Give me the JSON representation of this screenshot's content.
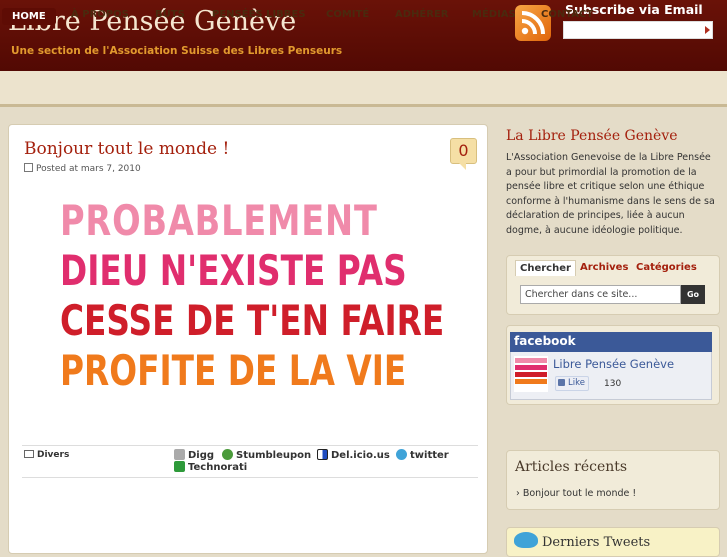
{
  "header": {
    "site_title": "Libre Pensée Genève",
    "tagline": "Une section de l'Association Suisse des Libres Penseurs",
    "subscribe_label": "Subscribe via Email",
    "subscribe_value": ""
  },
  "nav": {
    "items": [
      "HOME",
      "À PROPOS",
      "BUTS",
      "PENSÉES LIBRES",
      "COMITÉ",
      "ADHÉRER",
      "MÉDIAS",
      "CONTACT"
    ]
  },
  "post": {
    "title": "Bonjour tout le monde !",
    "meta": "Posted at mars 7, 2010",
    "comment_count": "0",
    "image_lines": [
      "PROBABLEMENT",
      "DIEU N'EXISTE PAS",
      "CESSE DE T'EN FAIRE",
      "PROFITE DE LA VIE"
    ],
    "category": "Divers",
    "share": [
      "Digg",
      "Stumbleupon",
      "Del.icio.us",
      "twitter",
      "Technorati"
    ]
  },
  "sidebar": {
    "about_title": "La Libre Pensée Genève",
    "about_text": "L'Association Genevoise de la Libre Pensée a pour but primordial la promotion de la pensée libre et critique selon une éthique conforme à l'humanisme dans le sens de sa déclaration de principes, liée à aucun dogme, à aucune idéologie politique.",
    "tabs": [
      "Chercher",
      "Archives",
      "Catégories"
    ],
    "search_placeholder": "Chercher dans ce site...",
    "go_label": "Go",
    "facebook": {
      "logo": "facebook",
      "page_name": "Libre Pensée Genève",
      "like_label": "Like",
      "like_count": "130"
    },
    "recent_title": "Articles récents",
    "recent_items": [
      "Bonjour tout le monde !"
    ],
    "twitter_text": "Derniers Tweets"
  },
  "colors": {
    "header_bg": "#5e0c04",
    "accent": "#a4200d",
    "tagline": "#e29a2e",
    "facebook": "#3b5998"
  },
  "icons": [
    "rss-icon",
    "calendar-icon",
    "folder-icon",
    "digg-icon",
    "stumbleupon-icon",
    "delicious-icon",
    "twitter-icon",
    "technorati-icon",
    "thumb-up-icon",
    "twitter-bird-icon"
  ]
}
